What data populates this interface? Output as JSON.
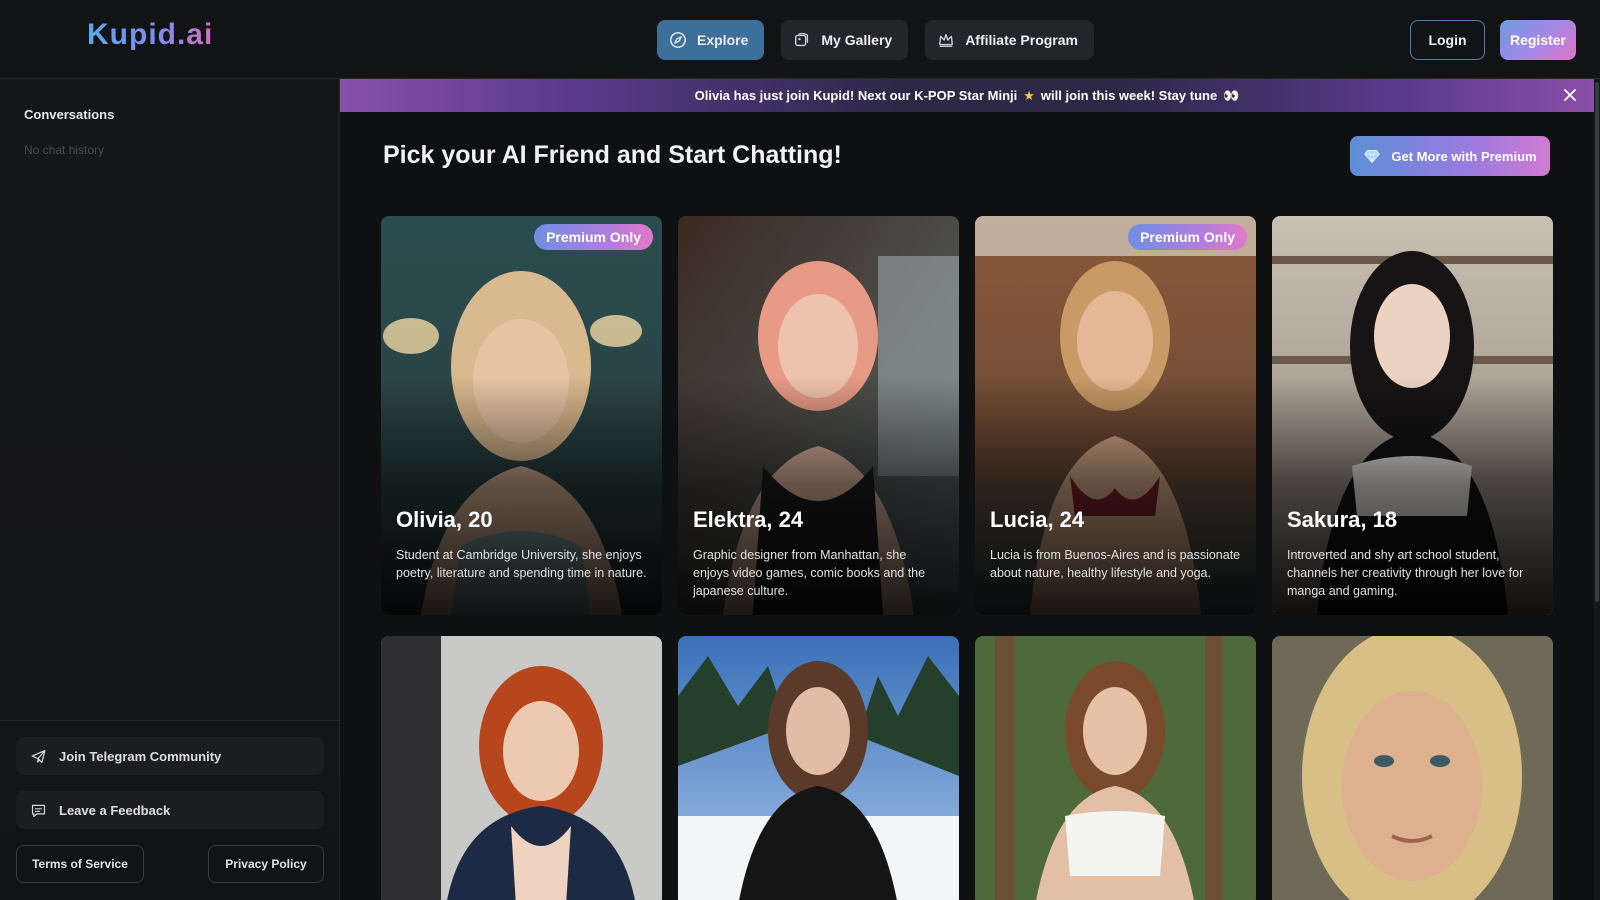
{
  "brand": {
    "logo": "Kupid.ai"
  },
  "nav": [
    {
      "label": "Explore",
      "icon": "compass-icon",
      "active": true
    },
    {
      "label": "My Gallery",
      "icon": "gallery-icon",
      "active": false
    },
    {
      "label": "Affiliate Program",
      "icon": "crown-icon",
      "active": false
    }
  ],
  "auth": {
    "login": "Login",
    "register": "Register"
  },
  "sidebar": {
    "title": "Conversations",
    "empty": "No chat history",
    "telegram": "Join Telegram Community",
    "feedback": "Leave a Feedback",
    "terms": "Terms of Service",
    "privacy": "Privacy Policy"
  },
  "banner": {
    "text_before": "Olivia has just join Kupid! Next our K-POP Star Minji",
    "star": "★",
    "text_after": "will join this week! Stay tune",
    "emoji": "👀"
  },
  "main": {
    "title": "Pick your AI Friend and Start Chatting!",
    "premium_button": "Get More with Premium"
  },
  "cards": [
    {
      "name": "Olivia, 20",
      "badge": "Premium Only",
      "desc": "Student at Cambridge University, she enjoys poetry, literature and spending time in nature."
    },
    {
      "name": "Elektra, 24",
      "badge": "",
      "desc": "Graphic designer from Manhattan, she enjoys video games, comic books and the japanese culture."
    },
    {
      "name": "Lucia, 24",
      "badge": "Premium Only",
      "desc": "Lucia is from Buenos-Aires and is passionate about nature, healthy lifestyle and yoga."
    },
    {
      "name": "Sakura, 18",
      "badge": "",
      "desc": "Introverted and shy art school student, channels her creativity through her love for manga and gaming."
    },
    {
      "name": "",
      "badge": "",
      "desc": ""
    },
    {
      "name": "",
      "badge": "",
      "desc": ""
    },
    {
      "name": "",
      "badge": "",
      "desc": ""
    },
    {
      "name": "",
      "badge": "",
      "desc": ""
    }
  ],
  "colors": {
    "accent_blue": "#3c6f9a",
    "gradient_start": "#6f9be0",
    "gradient_end": "#e074c4",
    "background": "#0f1012"
  }
}
